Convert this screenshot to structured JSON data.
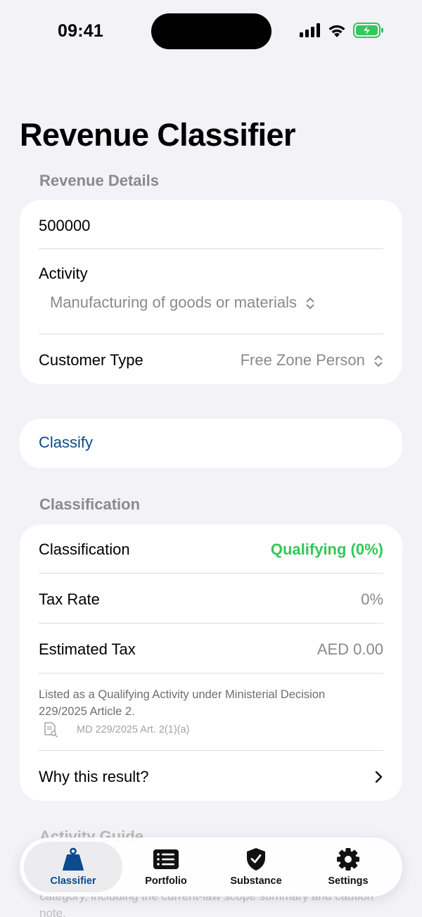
{
  "status_bar": {
    "time": "09:41"
  },
  "title": "Revenue Classifier",
  "revenue_details": {
    "header": "Revenue Details",
    "amount_value": "500000",
    "activity_label": "Activity",
    "activity_value": "Manufacturing of goods or materials",
    "customer_type_label": "Customer Type",
    "customer_type_value": "Free Zone Person"
  },
  "classify_button": "Classify",
  "classification": {
    "header": "Classification",
    "classification_label": "Classification",
    "classification_value": "Qualifying (0%)",
    "tax_rate_label": "Tax Rate",
    "tax_rate_value": "0%",
    "estimated_tax_label": "Estimated Tax",
    "estimated_tax_value": "AED 0.00",
    "note": "Listed as a Qualifying Activity under Ministerial Decision 229/2025 Article 2.",
    "reference": "MD 229/2025 Art. 2(1)(a)",
    "why_label": "Why this result?"
  },
  "activity_guide": {
    "header": "Activity Guide",
    "text": "category, including the current-law scope summary and caution note."
  },
  "tabs": [
    {
      "label": "Classifier",
      "icon": "weight-icon",
      "active": true
    },
    {
      "label": "Portfolio",
      "icon": "list-icon",
      "active": false
    },
    {
      "label": "Substance",
      "icon": "shield-check-icon",
      "active": false
    },
    {
      "label": "Settings",
      "icon": "gear-icon",
      "active": false
    }
  ],
  "colors": {
    "accent": "#0c4a8e",
    "qualifying": "#34c759",
    "background": "#f2f2f7"
  }
}
